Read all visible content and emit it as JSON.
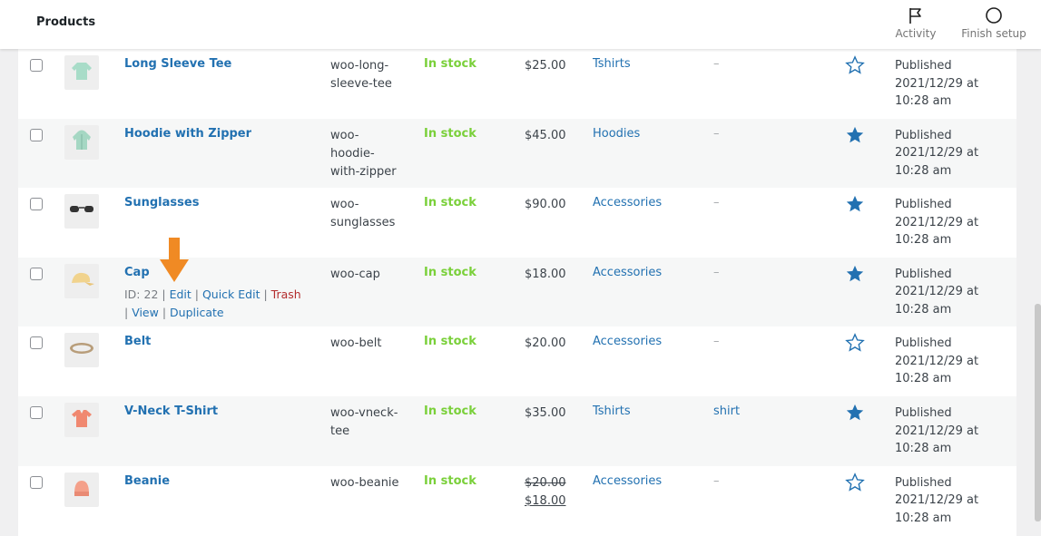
{
  "header": {
    "title": "Products",
    "activity_label": "Activity",
    "finish_setup_label": "Finish setup"
  },
  "products": [
    {
      "name": "Long Sleeve Tee",
      "sku": "woo-long-sleeve-tee",
      "stock": "In stock",
      "price": "$25.00",
      "category": "Tshirts",
      "tags": "–",
      "featured": false,
      "status": "Published",
      "date": "2021/12/29 at 10:28 am",
      "thumb": "long-sleeve-tee-thumbnail"
    },
    {
      "name": "Hoodie with Zipper",
      "sku": "woo-hoodie-with-zipper",
      "stock": "In stock",
      "price": "$45.00",
      "category": "Hoodies",
      "tags": "–",
      "featured": true,
      "status": "Published",
      "date": "2021/12/29 at 10:28 am",
      "thumb": "hoodie-thumbnail"
    },
    {
      "name": "Sunglasses",
      "sku": "woo-sunglasses",
      "stock": "In stock",
      "price": "$90.00",
      "category": "Accessories",
      "tags": "–",
      "featured": true,
      "status": "Published",
      "date": "2021/12/29 at 10:28 am",
      "thumb": "sunglasses-thumbnail"
    },
    {
      "name": "Cap",
      "sku": "woo-cap",
      "stock": "In stock",
      "price": "$18.00",
      "category": "Accessories",
      "tags": "–",
      "featured": true,
      "status": "Published",
      "date": "2021/12/29 at 10:28 am",
      "thumb": "cap-thumbnail"
    },
    {
      "name": "Belt",
      "sku": "woo-belt",
      "stock": "In stock",
      "price": "$20.00",
      "category": "Accessories",
      "tags": "–",
      "featured": false,
      "status": "Published",
      "date": "2021/12/29 at 10:28 am",
      "thumb": "belt-thumbnail"
    },
    {
      "name": "V-Neck T-Shirt",
      "sku": "woo-vneck-tee",
      "stock": "In stock",
      "price": "$35.00",
      "category": "Tshirts",
      "tags": "shirt",
      "featured": true,
      "status": "Published",
      "date": "2021/12/29 at 10:28 am",
      "thumb": "vneck-thumbnail"
    },
    {
      "name": "Beanie",
      "sku": "woo-beanie",
      "stock": "In stock",
      "price_regular": "$20.00",
      "price_sale": "$18.00",
      "category": "Accessories",
      "tags": "–",
      "featured": false,
      "status": "Published",
      "date": "2021/12/29 at 10:28 am",
      "thumb": "beanie-thumbnail"
    }
  ],
  "row_actions": {
    "id_text": "ID: 22",
    "edit": "Edit",
    "quick_edit": "Quick Edit",
    "trash": "Trash",
    "view": "View",
    "duplicate": "Duplicate"
  },
  "colors": {
    "link": "#2271b1",
    "in_stock": "#7ad03a",
    "trash": "#b32d2e",
    "arrow": "#f08a24",
    "star": "#2271b1"
  }
}
